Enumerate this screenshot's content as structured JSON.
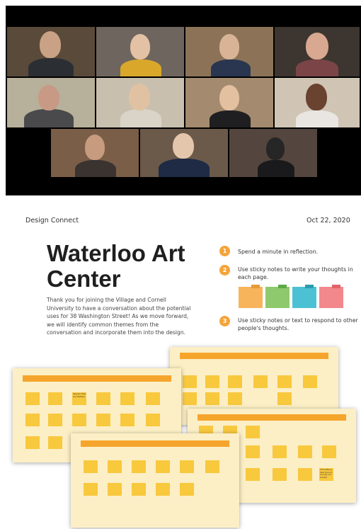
{
  "slide": {
    "org": "Design Connect",
    "date": "Oct 22, 2020",
    "title": "Waterloo Art Center",
    "description": "Thank you for joining the Village and Cornell University to have a conversation about the potential uses for 38 Washington Street! As we move forward, we will identify common themes from the conversation and incorporate them into the design.",
    "steps": [
      {
        "number": "1",
        "text": "Spend a minute in reflection."
      },
      {
        "number": "2",
        "text": "Use sticky notes to write your thoughts in each page."
      },
      {
        "number": "3",
        "text": "Use sticky notes or text to respond to other people's thoughts."
      }
    ],
    "note_colors": [
      "#f7b45b",
      "#8ec96d",
      "#4dc1d4",
      "#f2888c"
    ]
  },
  "boards": {
    "left": {
      "sticky_labels": [
        "Spaces that are flexible"
      ]
    },
    "right": {
      "sticky_labels": [
        "Third Place Year Round County Art Center"
      ]
    }
  },
  "colors": {
    "accent": "#f4a43a",
    "board_bg": "#fcefc5",
    "sticky": "#f8c83d"
  }
}
